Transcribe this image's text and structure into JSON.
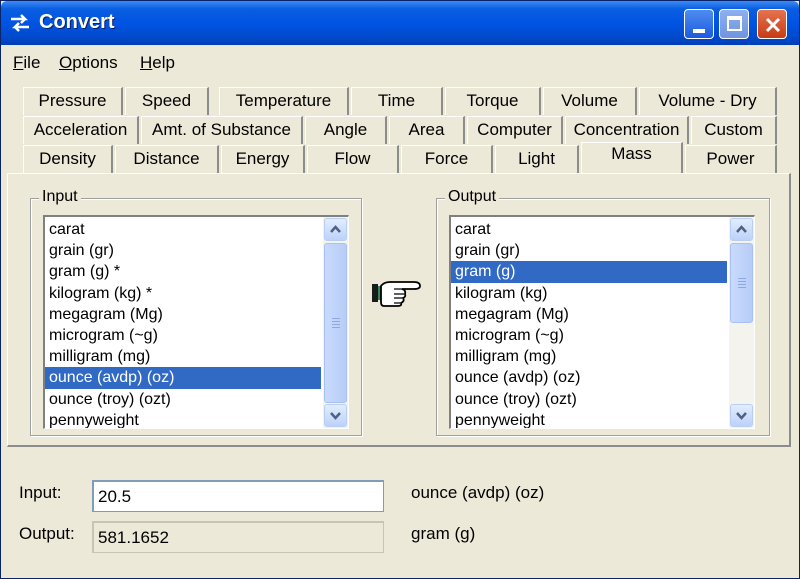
{
  "window": {
    "title": "Convert",
    "colors": {
      "title_bar": "#0054E3",
      "face": "#ECE9D8",
      "selection": "#316AC5"
    }
  },
  "menu": {
    "file": {
      "ul": "F",
      "rest": "ile"
    },
    "options": {
      "ul": "O",
      "rest": "ptions"
    },
    "help": {
      "ul": "H",
      "rest": "elp"
    }
  },
  "tabs": {
    "row1": [
      "Pressure",
      "Speed",
      "Temperature",
      "Time",
      "Torque",
      "Volume",
      "Volume - Dry"
    ],
    "row2": [
      "Acceleration",
      "Amt. of Substance",
      "Angle",
      "Area",
      "Computer",
      "Concentration",
      "Custom"
    ],
    "row3": [
      "Density",
      "Distance",
      "Energy",
      "Flow",
      "Force",
      "Light",
      "Mass",
      "Power"
    ],
    "selected": "Mass"
  },
  "input_group": {
    "label": "Input",
    "items": [
      "carat",
      "grain (gr)",
      "gram (g) *",
      "kilogram (kg) *",
      "megagram (Mg)",
      "microgram (~g)",
      "milligram (mg)",
      "ounce (avdp) (oz)",
      "ounce (troy) (ozt)",
      "pennyweight"
    ],
    "selected": "ounce (avdp) (oz)"
  },
  "output_group": {
    "label": "Output",
    "items": [
      "carat",
      "grain (gr)",
      "gram (g)",
      "kilogram (kg)",
      "megagram (Mg)",
      "microgram (~g)",
      "milligram (mg)",
      "ounce (avdp) (oz)",
      "ounce (troy) (ozt)",
      "pennyweight"
    ],
    "selected": "gram (g)"
  },
  "pointer_icon": "pointing-hand-icon",
  "fields": {
    "input_label": "Input:",
    "input_value": "20.5",
    "input_unit": "ounce (avdp) (oz)",
    "output_label": "Output:",
    "output_value": "581.1652",
    "output_unit": "gram (g)"
  }
}
